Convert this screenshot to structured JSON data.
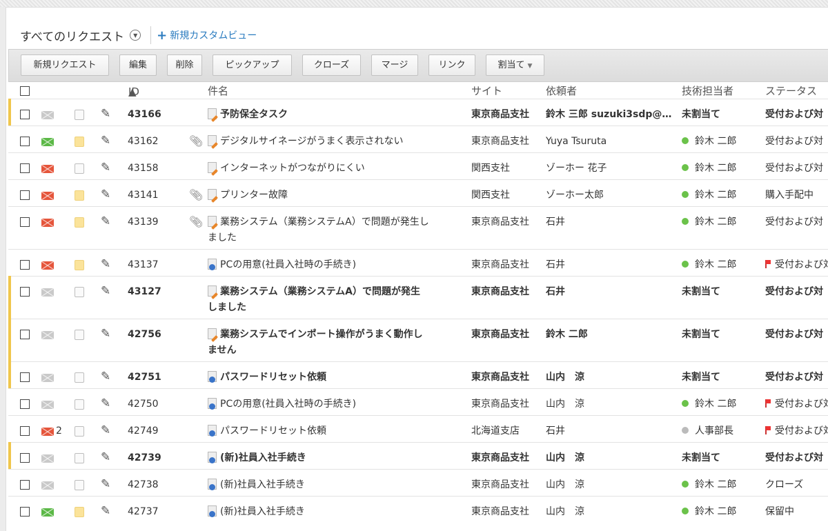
{
  "view": {
    "title": "すべてのリクエスト",
    "new_custom_view": "新規カスタムビュー"
  },
  "toolbar": {
    "new_request": "新規リクエスト",
    "edit": "編集",
    "delete": "削除",
    "pickup": "ピックアップ",
    "close": "クローズ",
    "merge": "マージ",
    "link": "リンク",
    "assign": "割当て"
  },
  "columns": {
    "id": "ID",
    "subject": "件名",
    "site": "サイト",
    "requester": "依頼者",
    "technician": "技術担当者",
    "status": "ステータス"
  },
  "rows": [
    {
      "unread": true,
      "mail": "gray",
      "mail_count": "",
      "note": "gray",
      "attachment": false,
      "type": "incident",
      "id": "43166",
      "subject": [
        "予防保全タスク"
      ],
      "site": "東京商品支社",
      "requester": "鈴木 三郎 suzuki3sdp@…",
      "technician": "未割当て",
      "tech_dot": "",
      "status": "受付および対",
      "flag": false
    },
    {
      "unread": false,
      "mail": "green",
      "mail_count": "",
      "note": "yellow",
      "attachment": true,
      "type": "incident",
      "id": "43162",
      "subject": [
        "デジタルサイネージがうまく表示されない"
      ],
      "site": "東京商品支社",
      "requester": "Yuya Tsuruta",
      "technician": "鈴木 二郎",
      "tech_dot": "green",
      "status": "受付および対",
      "flag": false
    },
    {
      "unread": false,
      "mail": "red",
      "mail_count": "",
      "note": "gray",
      "attachment": false,
      "type": "incident",
      "id": "43158",
      "subject": [
        "インターネットがつながりにくい"
      ],
      "site": "関西支社",
      "requester": "ゾーホー 花子",
      "technician": "鈴木 二郎",
      "tech_dot": "green",
      "status": "受付および対",
      "flag": false
    },
    {
      "unread": false,
      "mail": "red",
      "mail_count": "",
      "note": "yellow",
      "attachment": true,
      "type": "incident",
      "id": "43141",
      "subject": [
        "プリンター故障"
      ],
      "site": "関西支社",
      "requester": "ゾーホー太郎",
      "technician": "鈴木 二郎",
      "tech_dot": "green",
      "status": "購入手配中",
      "flag": false
    },
    {
      "unread": false,
      "mail": "red",
      "mail_count": "",
      "note": "yellow",
      "attachment": true,
      "type": "incident",
      "id": "43139",
      "subject": [
        "業務システム（業務システムA）で問題が発生し",
        "ました"
      ],
      "site": "東京商品支社",
      "requester": "石井",
      "technician": "鈴木 二郎",
      "tech_dot": "green",
      "status": "受付および対",
      "flag": false
    },
    {
      "unread": false,
      "mail": "red",
      "mail_count": "",
      "note": "yellow",
      "attachment": false,
      "type": "service",
      "id": "43137",
      "subject": [
        "PCの用意(社員入社時の手続き)"
      ],
      "site": "東京商品支社",
      "requester": "石井",
      "technician": "鈴木 二郎",
      "tech_dot": "green",
      "status": "受付および対",
      "flag": true
    },
    {
      "unread": true,
      "mail": "gray",
      "mail_count": "",
      "note": "gray",
      "attachment": false,
      "type": "incident",
      "id": "43127",
      "subject": [
        "業務システム（業務システムA）で問題が発生",
        "しました"
      ],
      "site": "東京商品支社",
      "requester": "石井",
      "technician": "未割当て",
      "tech_dot": "",
      "status": "受付および対",
      "flag": false
    },
    {
      "unread": true,
      "mail": "gray",
      "mail_count": "",
      "note": "gray",
      "attachment": false,
      "type": "incident",
      "id": "42756",
      "subject": [
        "業務システムでインポート操作がうまく動作し",
        "ません"
      ],
      "site": "東京商品支社",
      "requester": "鈴木 二郎",
      "technician": "未割当て",
      "tech_dot": "",
      "status": "受付および対",
      "flag": false
    },
    {
      "unread": true,
      "mail": "gray",
      "mail_count": "",
      "note": "gray",
      "attachment": false,
      "type": "service",
      "id": "42751",
      "subject": [
        "パスワードリセット依頼"
      ],
      "site": "東京商品支社",
      "requester": "山内　涼",
      "technician": "未割当て",
      "tech_dot": "",
      "status": "受付および対",
      "flag": false
    },
    {
      "unread": false,
      "mail": "gray",
      "mail_count": "",
      "note": "gray",
      "attachment": false,
      "type": "service",
      "id": "42750",
      "subject": [
        "PCの用意(社員入社時の手続き)"
      ],
      "site": "東京商品支社",
      "requester": "山内　涼",
      "technician": "鈴木 二郎",
      "tech_dot": "green",
      "status": "受付および対",
      "flag": true
    },
    {
      "unread": false,
      "mail": "red",
      "mail_count": "2",
      "note": "gray",
      "attachment": false,
      "type": "service",
      "id": "42749",
      "subject": [
        "パスワードリセット依頼"
      ],
      "site": "北海道支店",
      "requester": "石井",
      "technician": "人事部長",
      "tech_dot": "gray",
      "status": "受付および対",
      "flag": true
    },
    {
      "unread": true,
      "mail": "gray",
      "mail_count": "",
      "note": "gray",
      "attachment": false,
      "type": "service",
      "id": "42739",
      "subject": [
        "(新)社員入社手続き"
      ],
      "site": "東京商品支社",
      "requester": "山内　涼",
      "technician": "未割当て",
      "tech_dot": "",
      "status": "受付および対",
      "flag": false
    },
    {
      "unread": false,
      "mail": "gray",
      "mail_count": "",
      "note": "gray",
      "attachment": false,
      "type": "service",
      "id": "42738",
      "subject": [
        "(新)社員入社手続き"
      ],
      "site": "東京商品支社",
      "requester": "山内　涼",
      "technician": "鈴木 二郎",
      "tech_dot": "green",
      "status": "クローズ",
      "flag": false
    },
    {
      "unread": false,
      "mail": "green",
      "mail_count": "",
      "note": "yellow",
      "attachment": false,
      "type": "service",
      "id": "42737",
      "subject": [
        "(新)社員入社手続き"
      ],
      "site": "東京商品支社",
      "requester": "山内　涼",
      "technician": "鈴木 二郎",
      "tech_dot": "green",
      "status": "保留中",
      "flag": false
    }
  ]
}
